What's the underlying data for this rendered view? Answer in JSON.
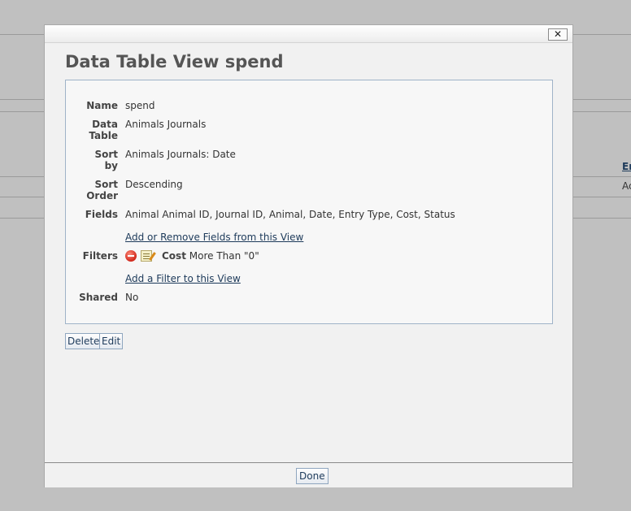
{
  "background": {
    "right_header": "Er",
    "right_value": "Ac"
  },
  "modal": {
    "close_label": "✕",
    "title": "Data Table View spend",
    "properties": {
      "name_label": "Name",
      "name_value": "spend",
      "data_table_label": "Data Table",
      "data_table_value": "Animals Journals",
      "sort_by_label": "Sort by",
      "sort_by_value": "Animals Journals: Date",
      "sort_order_label": "Sort Order",
      "sort_order_value": "Descending",
      "fields_label": "Fields",
      "fields_value": "Animal Animal ID, Journal ID, Animal, Date, Entry Type, Cost, Status",
      "fields_link": "Add or Remove Fields from this View",
      "filters_label": "Filters",
      "filter_field": "Cost",
      "filter_condition": "More Than \"0\"",
      "filters_link": "Add a Filter to this View",
      "shared_label": "Shared",
      "shared_value": "No"
    },
    "delete_label": "Delete",
    "edit_label": "Edit",
    "done_label": "Done"
  },
  "colors": {
    "overlay": "#c0c0c0",
    "modal_bg": "#f1f1f1",
    "link": "#1d3a5a",
    "panel_border": "#9fb3c8"
  }
}
